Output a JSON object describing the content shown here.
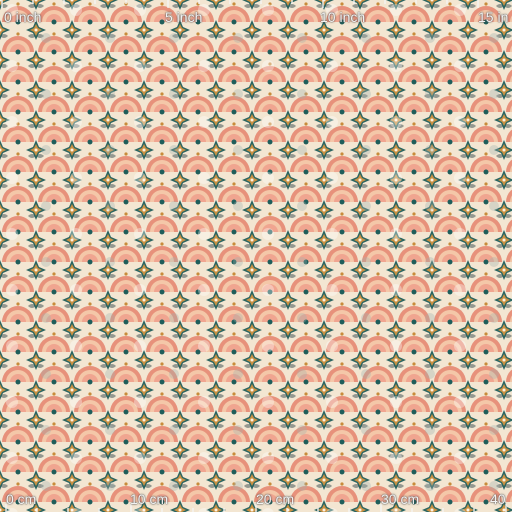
{
  "colors": {
    "background": "#f3e6d2",
    "coral": "#e5826c",
    "salmon": "#f0a590",
    "peach": "#f4c7a8",
    "teal": "#1f5e5b",
    "dark_teal": "#173f3d",
    "slate": "#6d7774",
    "mustard": "#c98c3a",
    "cream": "#fbf4e6",
    "gray_blue": "#9fb0ad"
  },
  "rulers": {
    "top": {
      "unit_labels": [
        "0 inch",
        "5 inch",
        "10 inch",
        "15 in"
      ]
    },
    "bottom": {
      "unit_labels": [
        "0 cm",
        "10 cm",
        "20 cm",
        "30 cm",
        "40"
      ]
    }
  }
}
